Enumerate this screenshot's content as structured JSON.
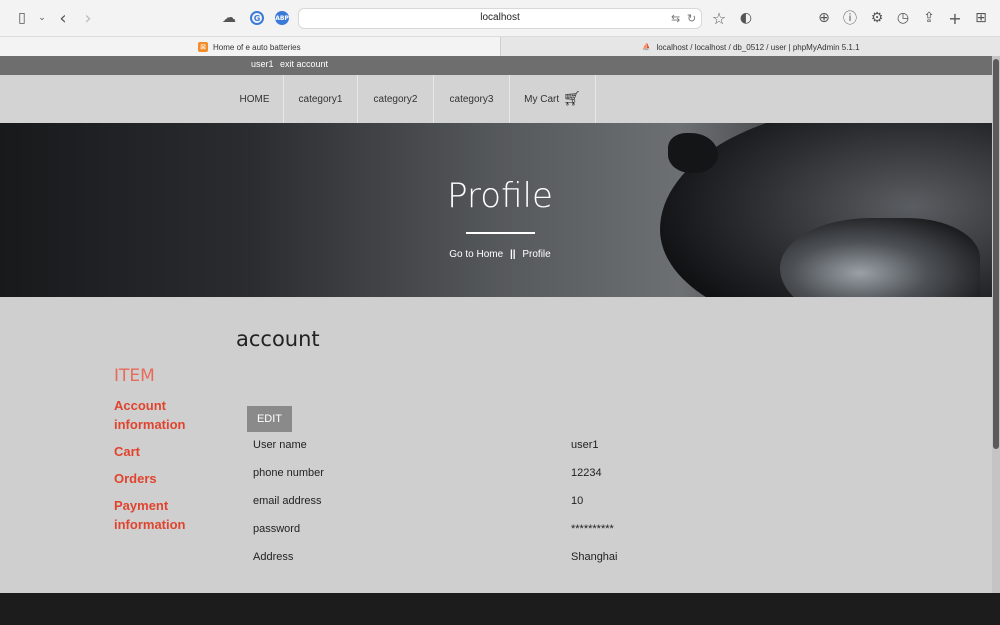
{
  "browser": {
    "url": "localhost",
    "tabs": [
      {
        "title": "Home of e auto batteries"
      },
      {
        "title": "localhost / localhost / db_0512 / user | phpMyAdmin 5.1.1"
      }
    ]
  },
  "userbar": {
    "username": "user1",
    "exit": "exit account"
  },
  "nav": {
    "items": [
      "HOME",
      "category1",
      "category2",
      "category3"
    ],
    "cart": "My Cart"
  },
  "hero": {
    "title": "Profile",
    "breadcrumb_home": "Go to Home",
    "breadcrumb_sep": "||",
    "breadcrumb_current": "Profile"
  },
  "sidebar": {
    "heading": "ITEM",
    "links": [
      "Account information",
      "Cart",
      "Orders",
      "Payment information"
    ]
  },
  "account": {
    "title": "account",
    "edit_label": "EDIT",
    "rows": [
      {
        "label": "User name",
        "value": "user1"
      },
      {
        "label": "phone number",
        "value": "12234"
      },
      {
        "label": "email address",
        "value": "10"
      },
      {
        "label": "password",
        "value": "**********"
      },
      {
        "label": "Address",
        "value": "Shanghai"
      }
    ]
  },
  "colors": {
    "accent": "#e0442e",
    "sidebar_heading": "#e86a5a",
    "userbar": "#6e6e6e",
    "footer": "#1c1c1c"
  }
}
